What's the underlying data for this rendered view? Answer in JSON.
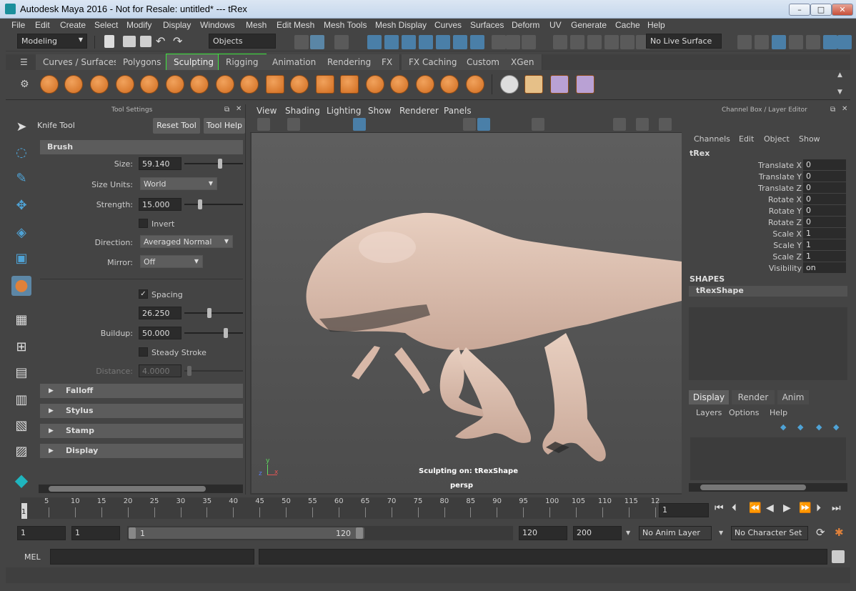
{
  "window": {
    "title": "Autodesk Maya 2016 - Not for Resale: untitled*   ---   tRex",
    "minimize": "–",
    "maximize": "□",
    "close": "✕"
  },
  "menubar": [
    "File",
    "Edit",
    "Create",
    "Select",
    "Modify",
    "Display",
    "Windows",
    "Mesh",
    "Edit Mesh",
    "Mesh Tools",
    "Mesh Display",
    "Curves",
    "Surfaces",
    "Deform",
    "UV",
    "Generate",
    "Cache",
    "Help"
  ],
  "statusline": {
    "mode": "Modeling",
    "selection_mode": "Objects",
    "live_surface": "No Live Surface"
  },
  "shelf": {
    "tabs": [
      "Curves / Surfaces",
      "Polygons",
      "Sculpting",
      "Rigging",
      "Animation",
      "Rendering",
      "FX",
      "FX Caching",
      "Custom",
      "XGen"
    ],
    "active_tab": "Sculpting"
  },
  "tool_settings": {
    "panel_title": "Tool Settings",
    "tool_name": "Knife Tool",
    "reset_button": "Reset Tool",
    "help_button": "Tool Help",
    "brush_section": "Brush",
    "size_label": "Size:",
    "size_value": "59.140",
    "size_level": 0.62,
    "size_units_label": "Size Units:",
    "size_units_value": "World",
    "strength_label": "Strength:",
    "strength_value": "15.000",
    "strength_level": 0.25,
    "invert_label": "Invert",
    "invert_checked": false,
    "direction_label": "Direction:",
    "direction_value": "Averaged Normal",
    "mirror_label": "Mirror:",
    "mirror_value": "Off",
    "spacing_label": "Spacing",
    "spacing_checked": true,
    "spacing_value": "26.250",
    "spacing_level": 0.42,
    "buildup_label": "Buildup:",
    "buildup_value": "50.000",
    "buildup_level": 0.72,
    "steady_label": "Steady Stroke",
    "steady_checked": false,
    "distance_label": "Distance:",
    "distance_value": "4.0000",
    "collapsed_sections": [
      "Falloff",
      "Stylus",
      "Stamp",
      "Display"
    ],
    "check_mark": "✓",
    "dropdown_arrow": "▼",
    "section_arrow": "▶"
  },
  "viewport": {
    "menus": [
      "View",
      "Shading",
      "Lighting",
      "Show",
      "Renderer",
      "Panels"
    ],
    "hud_sculpt": "Sculpting on: tRexShape",
    "camera": "persp",
    "axis_x": "x",
    "axis_y": "y",
    "axis_z": "z"
  },
  "channel_box": {
    "title": "Channel Box / Layer Editor",
    "menus": [
      "Channels",
      "Edit",
      "Object",
      "Show"
    ],
    "object": "tRex",
    "attributes": [
      {
        "name": "Translate X",
        "value": "0"
      },
      {
        "name": "Translate Y",
        "value": "0"
      },
      {
        "name": "Translate Z",
        "value": "0"
      },
      {
        "name": "Rotate X",
        "value": "0"
      },
      {
        "name": "Rotate Y",
        "value": "0"
      },
      {
        "name": "Rotate Z",
        "value": "0"
      },
      {
        "name": "Scale X",
        "value": "1"
      },
      {
        "name": "Scale Y",
        "value": "1"
      },
      {
        "name": "Scale Z",
        "value": "1"
      },
      {
        "name": "Visibility",
        "value": "on"
      }
    ],
    "shapes_header": "SHAPES",
    "shape": "tRexShape",
    "layer_tabs": [
      "Display",
      "Render",
      "Anim"
    ],
    "layer_menus": [
      "Layers",
      "Options",
      "Help"
    ]
  },
  "timeline": {
    "ticks": [
      "5",
      "10",
      "15",
      "20",
      "25",
      "30",
      "35",
      "40",
      "45",
      "50",
      "55",
      "60",
      "65",
      "70",
      "75",
      "80",
      "85",
      "90",
      "95",
      "100",
      "105",
      "110",
      "115",
      "12"
    ],
    "current_frame_marker": "1",
    "current_frame": "1",
    "range_start": "1",
    "playback_start": "1",
    "range_bar_start": "1",
    "range_bar_end": "120",
    "playback_end": "120",
    "range_end": "200",
    "anim_layer": "No Anim Layer",
    "character_set": "No Character Set"
  },
  "command_line": {
    "label": "MEL"
  },
  "colors": {
    "accent": "#4fa3d6",
    "sculpt_orange": "#e0813a",
    "active_tab_outline": "#3ee63e"
  }
}
